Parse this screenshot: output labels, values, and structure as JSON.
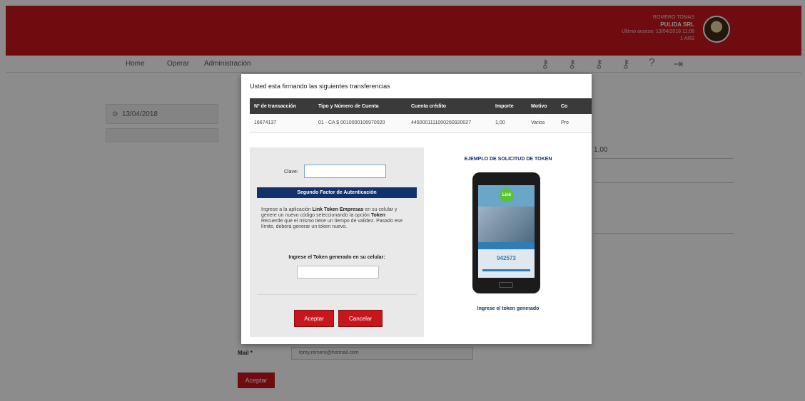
{
  "header": {
    "user_name": "ROMERO TOMAS",
    "company": "PULIDA SRL",
    "last_access": "Último acceso: 13/04/2018 11:08",
    "user_id": "1 ARS",
    "brand_color": "#c8161d"
  },
  "nav": {
    "items": [
      "Home",
      "Operar",
      "Administración"
    ],
    "icons": [
      "key-icon",
      "key-icon",
      "key-icon",
      "key-icon",
      "help-icon",
      "logout-icon"
    ]
  },
  "background": {
    "date": "13/04/2018",
    "amount": "1,00",
    "mail_label": "Mail *",
    "mail_value": "tomy.romero@hotmail.com",
    "accept_label": "Aceptar"
  },
  "modal": {
    "title": "Usted esta firmando las siguientes transferencias",
    "table": {
      "headers": [
        "Nº de transacción",
        "Tipo y Número de Cuenta",
        "Cuenta crédito",
        "Importe",
        "Motivo",
        "Co"
      ],
      "rows": [
        [
          "16674137",
          "01 - CA $ 0010000106970020",
          "4450001111000260920027",
          "1,00",
          "Varios",
          "Pro"
        ]
      ]
    },
    "auth": {
      "clave_label": "Clave:",
      "factor_title": "Segundo Factor de Autenticación",
      "instructions_1": "Ingrese a la aplicación",
      "app_name": "Link Token Empresas",
      "instructions_2": "en su celular y genere un nuevo código seleccionando la opción",
      "option_name": "Token",
      "instructions_3": "Recuerde que el mismo tiene un tiempo de validez. Pasado ese límite, deberá generar un token nuevo.",
      "token_label": "Ingrese el Token generado en su celular:",
      "accept_label": "Aceptar",
      "cancel_label": "Cancelar"
    },
    "example": {
      "title": "EJEMPLO DE SOLICITUD DE TOKEN",
      "logo_text": "Link",
      "token_code": "942573",
      "caption": "Ingrese el token generado"
    }
  }
}
